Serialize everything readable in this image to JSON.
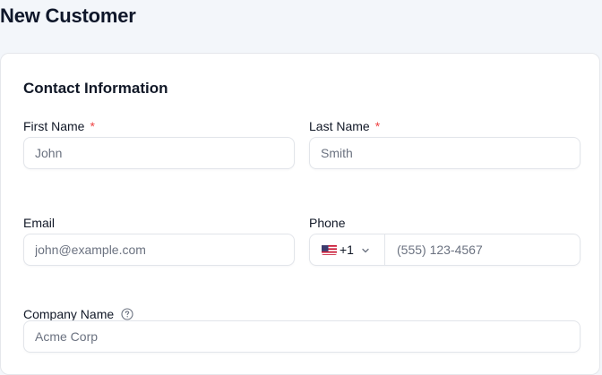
{
  "page": {
    "title": "New Customer"
  },
  "section": {
    "title": "Contact Information"
  },
  "fields": {
    "first_name": {
      "label": "First Name",
      "required_mark": "*",
      "value": "",
      "placeholder": "John"
    },
    "last_name": {
      "label": "Last Name",
      "required_mark": "*",
      "value": "",
      "placeholder": "Smith"
    },
    "email": {
      "label": "Email",
      "value": "",
      "placeholder": "john@example.com"
    },
    "phone": {
      "label": "Phone",
      "country_icon": "us-flag-icon",
      "country_code": "+1",
      "value": "",
      "placeholder": "(555) 123-4567"
    },
    "company_name": {
      "label": "Company Name",
      "help_icon": "help-circle-icon",
      "value": "",
      "placeholder": "Acme Corp"
    }
  },
  "colors": {
    "background": "#f3f6fa",
    "card": "#ffffff",
    "border": "#e2e5ea",
    "required": "#ef4444",
    "placeholder": "#6b7280"
  }
}
